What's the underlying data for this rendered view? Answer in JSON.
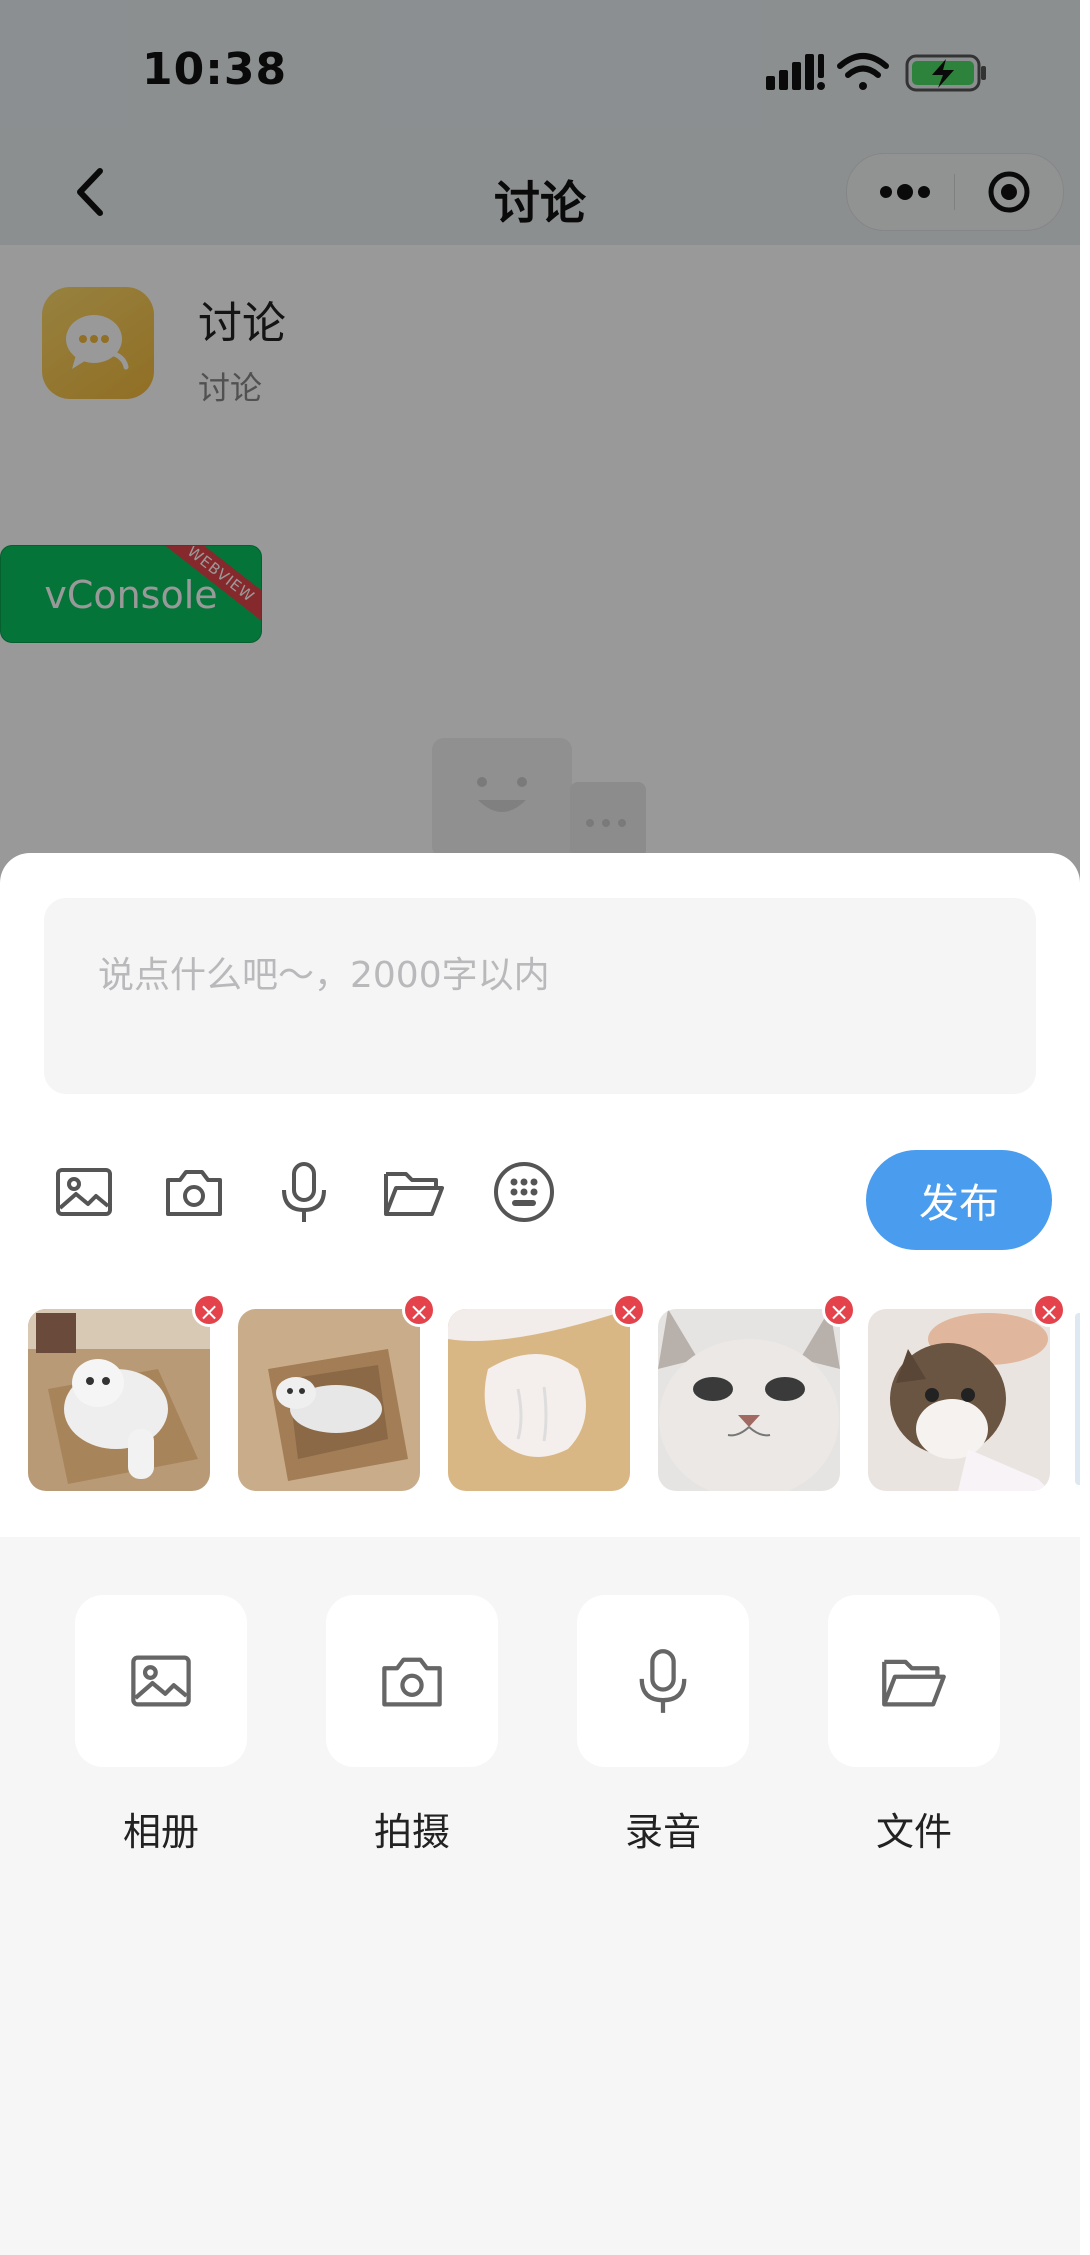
{
  "status_bar": {
    "time": "10:38"
  },
  "nav": {
    "title": "讨论"
  },
  "header": {
    "title": "讨论",
    "subtitle": "讨论"
  },
  "vconsole": {
    "label": "vConsole",
    "ribbon": "WEBVIEW"
  },
  "composer": {
    "placeholder": "说点什么吧～，2000字以内",
    "value": "",
    "publish_label": "发布"
  },
  "toolbar_icons": [
    "image-icon",
    "camera-icon",
    "microphone-icon",
    "folder-icon",
    "keypad-icon"
  ],
  "thumbnails": [
    {
      "name": "cat-in-box-photo",
      "delete_glyph": "×"
    },
    {
      "name": "cat-lying-in-box-photo",
      "delete_glyph": "×"
    },
    {
      "name": "cat-paw-photo",
      "delete_glyph": "×"
    },
    {
      "name": "cat-face-photo",
      "delete_glyph": "×"
    },
    {
      "name": "tabby-cat-photo",
      "delete_glyph": "×"
    }
  ],
  "attach_panel": {
    "items": [
      {
        "label": "相册",
        "icon": "image-icon"
      },
      {
        "label": "拍摄",
        "icon": "camera-icon"
      },
      {
        "label": "录音",
        "icon": "microphone-icon"
      },
      {
        "label": "文件",
        "icon": "folder-icon"
      }
    ]
  },
  "colors": {
    "accent": "#4a9cee",
    "delete_badge": "#e4434b",
    "vconsole": "#07c160",
    "overlay": "rgba(0,0,0,0.40)"
  }
}
